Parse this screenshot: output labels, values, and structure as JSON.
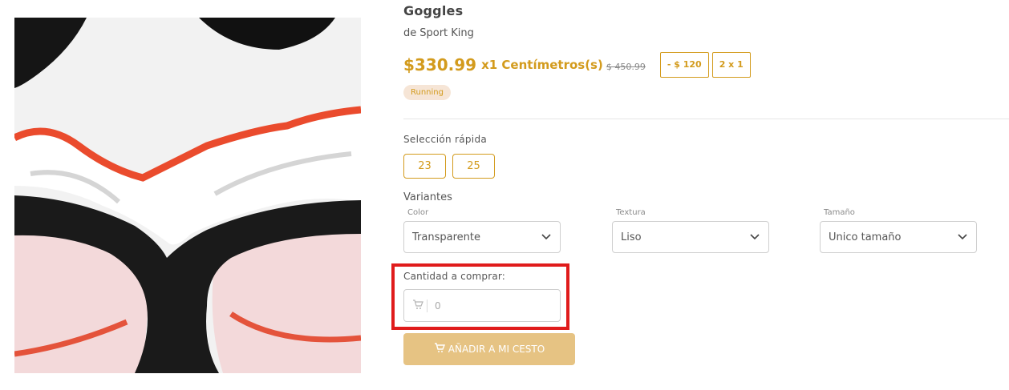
{
  "product": {
    "title": "Goggles",
    "brand_prefix": "de",
    "brand": "Sport King",
    "price": "$330.99",
    "unit": "x1 Centímetros(s)",
    "old_price": "$ 450.99",
    "promos": [
      "- $ 120",
      "2 x 1"
    ],
    "tag": "Running"
  },
  "quick_select": {
    "label": "Selección rápida",
    "options": [
      "23",
      "25"
    ]
  },
  "variants": {
    "label": "Variantes",
    "fields": [
      {
        "label": "Color",
        "value": "Transparente"
      },
      {
        "label": "Textura",
        "value": "Liso"
      },
      {
        "label": "Tamaño",
        "value": "Unico tamaño"
      }
    ]
  },
  "quantity": {
    "label": "Cantidad a comprar:",
    "placeholder": "0"
  },
  "cart_button": {
    "label": "AÑADIR A MI CESTO"
  },
  "icons": {
    "cart": "cart-icon",
    "chevron": "chevron-down-icon"
  },
  "colors": {
    "accent": "#d39b1d",
    "highlight_box": "#e01b1b",
    "button_bg": "#e6c383",
    "tag_bg": "#f6e5d6"
  }
}
